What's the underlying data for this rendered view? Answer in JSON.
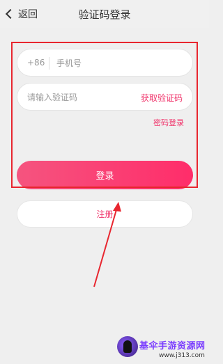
{
  "header": {
    "back_label": "返回",
    "title": "验证码登录"
  },
  "form": {
    "country_code": "+86",
    "phone_placeholder": "手机号",
    "code_placeholder": "请输入验证码",
    "get_code_label": "获取验证码",
    "password_login_label": "密码登录",
    "login_label": "登录",
    "register_label": "注册"
  },
  "annotation": {
    "highlight_color": "#e8262f",
    "arrow_color": "#e8262f"
  },
  "watermark": {
    "name": "基伞手游资源网",
    "url": "www.j313.com"
  },
  "colors": {
    "accent": "#f0336a",
    "button_gradient_start": "#f5547f",
    "button_gradient_end": "#ff2d6a"
  }
}
